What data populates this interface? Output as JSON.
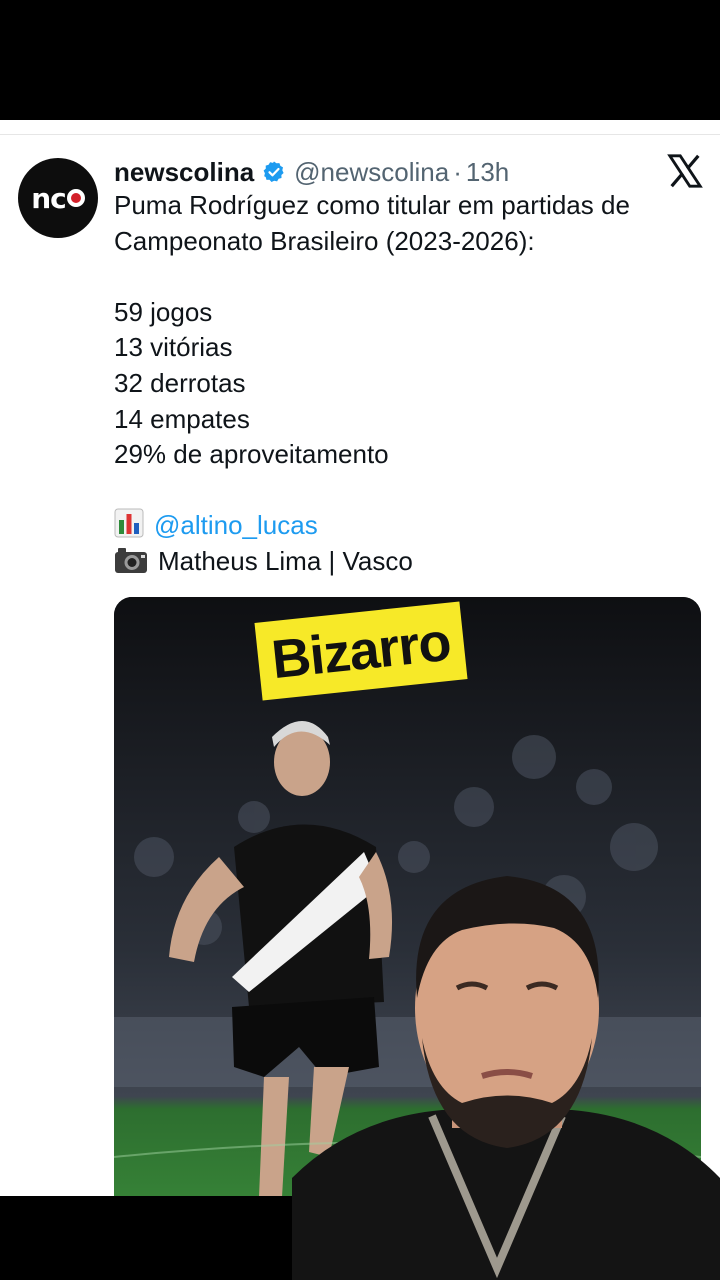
{
  "tweet": {
    "display_name": "newscolina",
    "handle": "@newscolina",
    "separator": "·",
    "time": "13h",
    "avatar_logo": "nc",
    "lines": [
      "Puma Rodríguez como titular em partidas de",
      "Campeonato Brasileiro (2023-2026):",
      "",
      "59 jogos",
      "13 vitórias",
      "32 derrotas",
      "14 empates",
      "29% de aproveitamento",
      ""
    ],
    "stats_credit": "@altino_lucas",
    "photo_credit": "Matheus Lima | Vasco"
  },
  "overlay": {
    "caption": "Bizarro"
  },
  "colors": {
    "accent": "#1d9bf0",
    "caption_bg": "#f7e928",
    "text": "#0f1419",
    "secondary_text": "#536471"
  },
  "icons": [
    "verified-badge-icon",
    "x-logo-icon",
    "bar-chart-icon",
    "camera-icon"
  ]
}
